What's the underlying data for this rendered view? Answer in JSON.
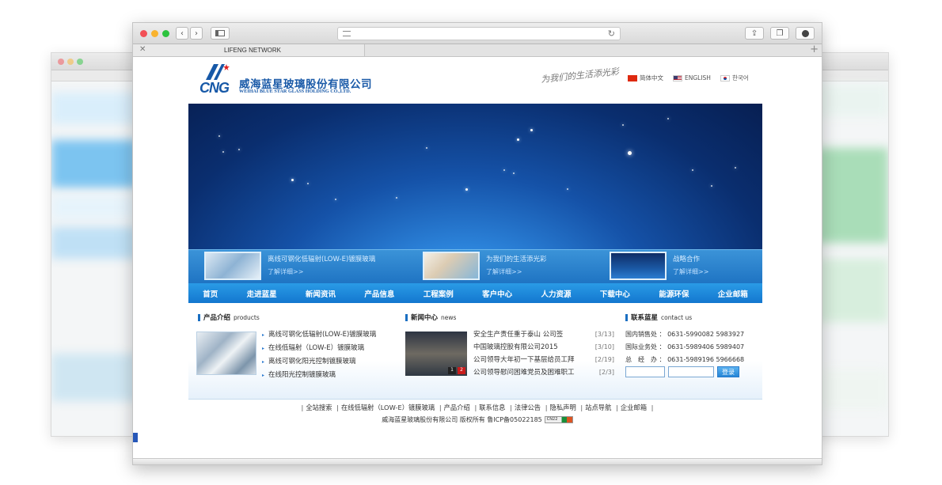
{
  "browser": {
    "tab_title": "LIFENG NETWORK",
    "tab_close": "✕",
    "tab_plus": "+",
    "back": "‹",
    "forward": "›"
  },
  "header": {
    "logo_mark_text": "CNG",
    "company_cn": "威海蓝星玻璃股份有限公司",
    "company_en": "WEIHAI BLUE STAR GLASS HOLDING CO.,LTD.",
    "slogan": "为我们的生活添光彩",
    "languages": [
      {
        "label": "简体中文",
        "flag": "cn"
      },
      {
        "label": "ENGLISH",
        "flag": "us"
      },
      {
        "label": "한국어",
        "flag": "kr"
      }
    ]
  },
  "banner": {
    "promos": [
      {
        "title": "离线可钢化低辐射(LOW-E)镀膜玻璃",
        "more": "了解详细>>"
      },
      {
        "title": "为我们的生活添光彩",
        "more": "了解详细>>"
      },
      {
        "title": "战略合作",
        "more": "了解详细>>"
      }
    ]
  },
  "nav": {
    "items": [
      "首页",
      "走进蓝星",
      "新闻资讯",
      "产品信息",
      "工程案例",
      "客户中心",
      "人力资源",
      "下载中心",
      "能源环保",
      "企业邮箱"
    ]
  },
  "products": {
    "title": "产品介绍",
    "subtitle": "products",
    "items": [
      "离线可钢化低辐射(LOW-E)镀膜玻璃",
      "在线低辐射（LOW-E）镀膜玻璃",
      "离线可钢化阳光控制镀膜玻璃",
      "在线阳光控制镀膜玻璃"
    ]
  },
  "news": {
    "title": "新闻中心",
    "subtitle": "news",
    "image_badges": [
      "1",
      "2"
    ],
    "items": [
      {
        "title": "安全生产责任重于泰山 公司签",
        "date": "[3/13]"
      },
      {
        "title": "中国玻璃控股有限公司2015",
        "date": "[3/10]"
      },
      {
        "title": "公司领导大年初一下基层给员工拜",
        "date": "[2/19]"
      },
      {
        "title": "公司领导慰问困难党员及困难职工",
        "date": "[2/3]"
      }
    ]
  },
  "contact": {
    "title": "联系蓝星",
    "subtitle": "contact us",
    "lines": [
      "国内销售处 ： 0631-5990082  5983927",
      "国际业务处 ： 0631-5989406  5989407",
      "总　经　办 ： 0631-5989196  5966668"
    ],
    "login_label": "登录"
  },
  "footer": {
    "links": [
      "全站搜索",
      "在线低辐射（LOW-E）镀膜玻璃",
      "产品介绍",
      "联系信息",
      "法律公告",
      "隐私声明",
      "站点导航",
      "企业邮箱"
    ],
    "copyright": "威海蓝星玻璃股份有限公司  版权所有  鲁ICP备05022185",
    "badge": "CN22"
  }
}
